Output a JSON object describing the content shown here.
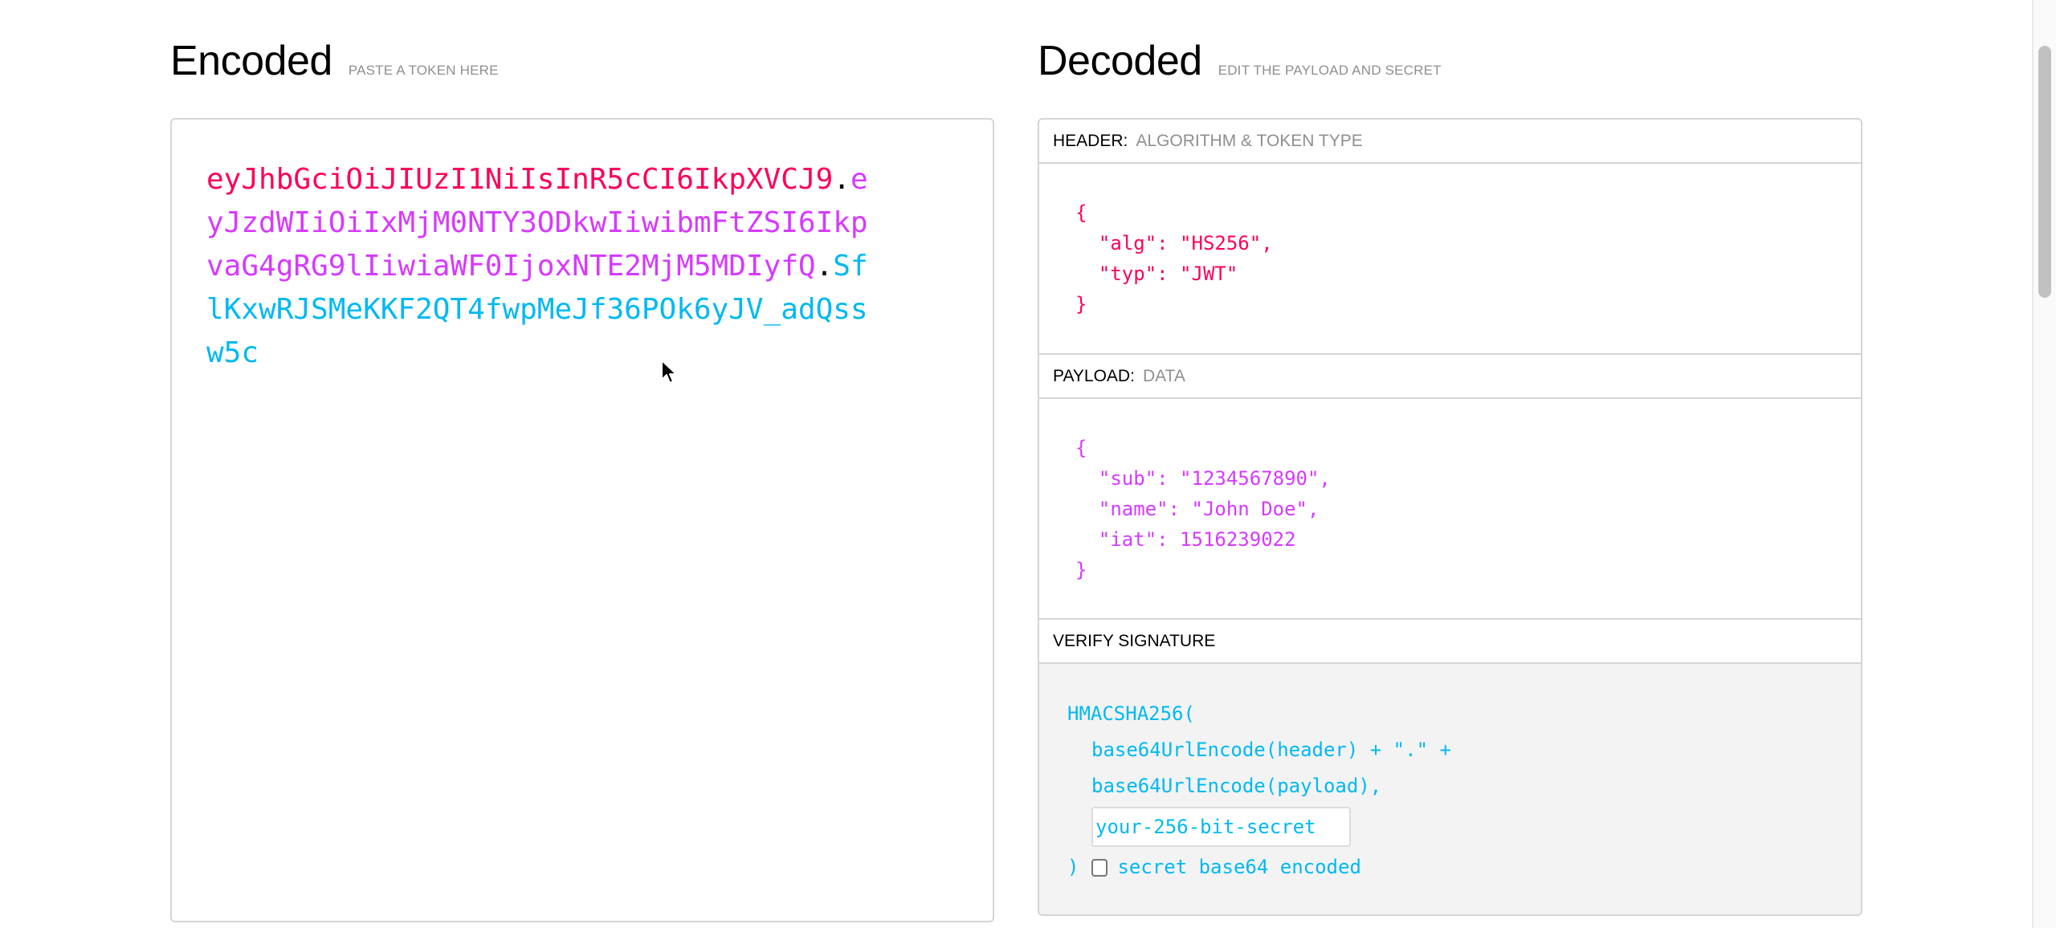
{
  "encoded": {
    "title": "Encoded",
    "subtitle": "PASTE A TOKEN HERE",
    "token": {
      "header": "eyJhbGciOiJIUzI1NiIsInR5cCI6IkpXVCJ9",
      "payload": "eyJzdWIiOiIxMjM0NTY3ODkwIiwibmFtZSI6IkpvaG4gRG9lIiwiaWF0IjoxNTE2MjM5MDIyfQ",
      "signature": "SflKxwRJSMeKKF2QT4fwpMeJf36POk6yJV_adQssw5c",
      "separator": "."
    }
  },
  "decoded": {
    "title": "Decoded",
    "subtitle": "EDIT THE PAYLOAD AND SECRET",
    "header_section": {
      "label": "HEADER:",
      "description": "ALGORITHM & TOKEN TYPE",
      "json_text": "{\n  \"alg\": \"HS256\",\n  \"typ\": \"JWT\"\n}"
    },
    "payload_section": {
      "label": "PAYLOAD:",
      "description": "DATA",
      "json_text": "{\n  \"sub\": \"1234567890\",\n  \"name\": \"John Doe\",\n  \"iat\": 1516239022\n}"
    },
    "verify_section": {
      "label": "VERIFY SIGNATURE",
      "line1": "HMACSHA256(",
      "line2": "base64UrlEncode(header) + \".\" +",
      "line3": "base64UrlEncode(payload),",
      "secret_value": "your-256-bit-secret",
      "close_paren": ")",
      "checkbox_label": "secret base64 encoded",
      "checkbox_checked": false
    }
  },
  "colors": {
    "header": "#fb015b",
    "payload": "#d63aff",
    "signature": "#00b9f1"
  }
}
